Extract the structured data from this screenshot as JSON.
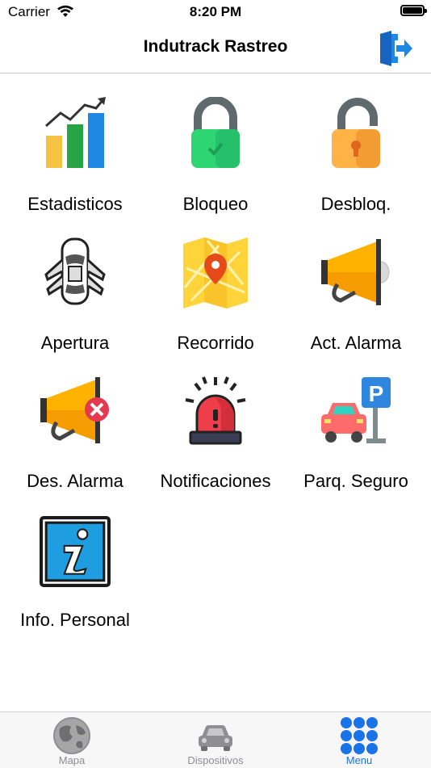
{
  "status_bar": {
    "carrier": "Carrier",
    "time": "8:20 PM"
  },
  "nav": {
    "title": "Indutrack Rastreo",
    "action_icon": "logout-icon"
  },
  "menu": {
    "items": [
      {
        "label": "Estadisticos",
        "icon": "bar-chart-icon"
      },
      {
        "label": "Bloqueo",
        "icon": "locked-padlock-icon"
      },
      {
        "label": "Desbloq.",
        "icon": "unlocked-padlock-icon"
      },
      {
        "label": "Apertura",
        "icon": "car-doors-open-icon"
      },
      {
        "label": "Recorrido",
        "icon": "map-pin-icon"
      },
      {
        "label": "Act. Alarma",
        "icon": "megaphone-icon"
      },
      {
        "label": "Des. Alarma",
        "icon": "megaphone-off-icon"
      },
      {
        "label": "Notificaciones",
        "icon": "siren-icon"
      },
      {
        "label": "Parq. Seguro",
        "icon": "parking-icon"
      },
      {
        "label": "Info. Personal",
        "icon": "info-icon"
      }
    ]
  },
  "tabs": [
    {
      "label": "Mapa",
      "icon": "globe-icon",
      "active": false
    },
    {
      "label": "Dispositivos",
      "icon": "car-icon",
      "active": false
    },
    {
      "label": "Menu",
      "icon": "grid-icon",
      "active": true
    }
  ],
  "colors": {
    "accent": "#1a73e8",
    "inactive": "#8e8e93",
    "divider": "#c8c8c8"
  }
}
